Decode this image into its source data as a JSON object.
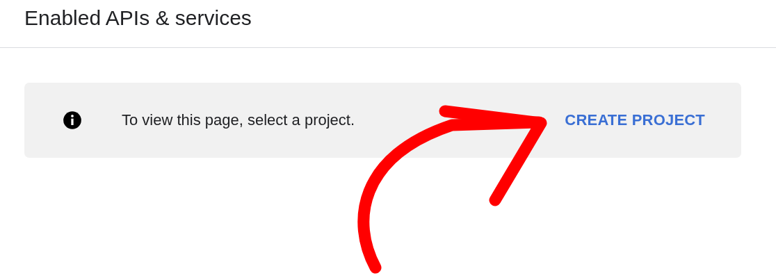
{
  "page": {
    "title": "Enabled APIs & services"
  },
  "notice": {
    "message": "To view this page, select a project.",
    "action": "CREATE PROJECT"
  },
  "annotations": [
    {
      "kind": "arrow"
    }
  ]
}
